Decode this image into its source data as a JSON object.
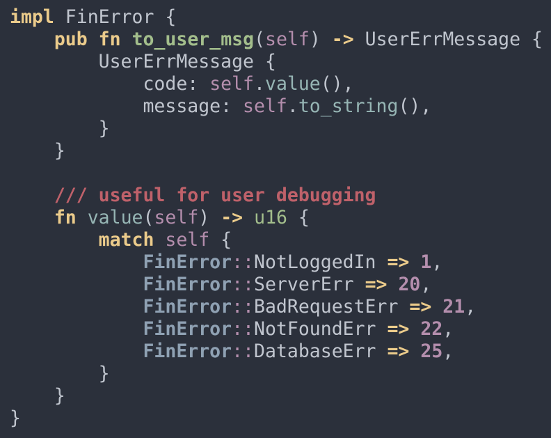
{
  "editor": {
    "background": "#2b303b",
    "lines": [
      [
        {
          "t": "impl",
          "c": "kw"
        },
        {
          "t": " FinError {",
          "c": "ty"
        }
      ],
      [
        {
          "t": "    ",
          "c": "punct"
        },
        {
          "t": "pub",
          "c": "kw"
        },
        {
          "t": " ",
          "c": "punct"
        },
        {
          "t": "fn",
          "c": "kw"
        },
        {
          "t": " ",
          "c": "punct"
        },
        {
          "t": "to_user_msg",
          "c": "fn"
        },
        {
          "t": "(",
          "c": "punct"
        },
        {
          "t": "self",
          "c": "self"
        },
        {
          "t": ") ",
          "c": "punct"
        },
        {
          "t": "->",
          "c": "op"
        },
        {
          "t": " UserErrMessage {",
          "c": "ty"
        }
      ],
      [
        {
          "t": "        UserErrMessage {",
          "c": "ty"
        }
      ],
      [
        {
          "t": "            code: ",
          "c": "field"
        },
        {
          "t": "self",
          "c": "self"
        },
        {
          "t": ".",
          "c": "punct"
        },
        {
          "t": "value",
          "c": "method"
        },
        {
          "t": "(),",
          "c": "punct"
        }
      ],
      [
        {
          "t": "            message: ",
          "c": "field"
        },
        {
          "t": "self",
          "c": "self"
        },
        {
          "t": ".",
          "c": "punct"
        },
        {
          "t": "to_string",
          "c": "method"
        },
        {
          "t": "(),",
          "c": "punct"
        }
      ],
      [
        {
          "t": "        }",
          "c": "punct"
        }
      ],
      [
        {
          "t": "    }",
          "c": "punct"
        }
      ],
      [
        {
          "t": "",
          "c": "punct"
        }
      ],
      [
        {
          "t": "    ",
          "c": "punct"
        },
        {
          "t": "/// useful for user debugging",
          "c": "comment"
        }
      ],
      [
        {
          "t": "    ",
          "c": "punct"
        },
        {
          "t": "fn",
          "c": "kw"
        },
        {
          "t": " ",
          "c": "punct"
        },
        {
          "t": "value",
          "c": "fnplain"
        },
        {
          "t": "(",
          "c": "punct"
        },
        {
          "t": "self",
          "c": "self"
        },
        {
          "t": ") ",
          "c": "punct"
        },
        {
          "t": "->",
          "c": "op"
        },
        {
          "t": " ",
          "c": "punct"
        },
        {
          "t": "u16",
          "c": "prim"
        },
        {
          "t": " {",
          "c": "punct"
        }
      ],
      [
        {
          "t": "        ",
          "c": "punct"
        },
        {
          "t": "match",
          "c": "kw"
        },
        {
          "t": " ",
          "c": "punct"
        },
        {
          "t": "self",
          "c": "self"
        },
        {
          "t": " {",
          "c": "punct"
        }
      ],
      [
        {
          "t": "            ",
          "c": "punct"
        },
        {
          "t": "FinError",
          "c": "path"
        },
        {
          "t": "::",
          "c": "sep"
        },
        {
          "t": "NotLoggedIn ",
          "c": "variant"
        },
        {
          "t": "=>",
          "c": "op"
        },
        {
          "t": " ",
          "c": "punct"
        },
        {
          "t": "1",
          "c": "num"
        },
        {
          "t": ",",
          "c": "punct"
        }
      ],
      [
        {
          "t": "            ",
          "c": "punct"
        },
        {
          "t": "FinError",
          "c": "path"
        },
        {
          "t": "::",
          "c": "sep"
        },
        {
          "t": "ServerErr ",
          "c": "variant"
        },
        {
          "t": "=>",
          "c": "op"
        },
        {
          "t": " ",
          "c": "punct"
        },
        {
          "t": "20",
          "c": "num"
        },
        {
          "t": ",",
          "c": "punct"
        }
      ],
      [
        {
          "t": "            ",
          "c": "punct"
        },
        {
          "t": "FinError",
          "c": "path"
        },
        {
          "t": "::",
          "c": "sep"
        },
        {
          "t": "BadRequestErr ",
          "c": "variant"
        },
        {
          "t": "=>",
          "c": "op"
        },
        {
          "t": " ",
          "c": "punct"
        },
        {
          "t": "21",
          "c": "num"
        },
        {
          "t": ",",
          "c": "punct"
        }
      ],
      [
        {
          "t": "            ",
          "c": "punct"
        },
        {
          "t": "FinError",
          "c": "path"
        },
        {
          "t": "::",
          "c": "sep"
        },
        {
          "t": "NotFoundErr ",
          "c": "variant"
        },
        {
          "t": "=>",
          "c": "op"
        },
        {
          "t": " ",
          "c": "punct"
        },
        {
          "t": "22",
          "c": "num"
        },
        {
          "t": ",",
          "c": "punct"
        }
      ],
      [
        {
          "t": "            ",
          "c": "punct"
        },
        {
          "t": "FinError",
          "c": "path"
        },
        {
          "t": "::",
          "c": "sep"
        },
        {
          "t": "DatabaseErr ",
          "c": "variant"
        },
        {
          "t": "=>",
          "c": "op"
        },
        {
          "t": " ",
          "c": "punct"
        },
        {
          "t": "25",
          "c": "num"
        },
        {
          "t": ",",
          "c": "punct"
        }
      ],
      [
        {
          "t": "        }",
          "c": "punct"
        }
      ],
      [
        {
          "t": "    }",
          "c": "punct"
        }
      ],
      [
        {
          "t": "}",
          "c": "punct"
        }
      ]
    ]
  }
}
